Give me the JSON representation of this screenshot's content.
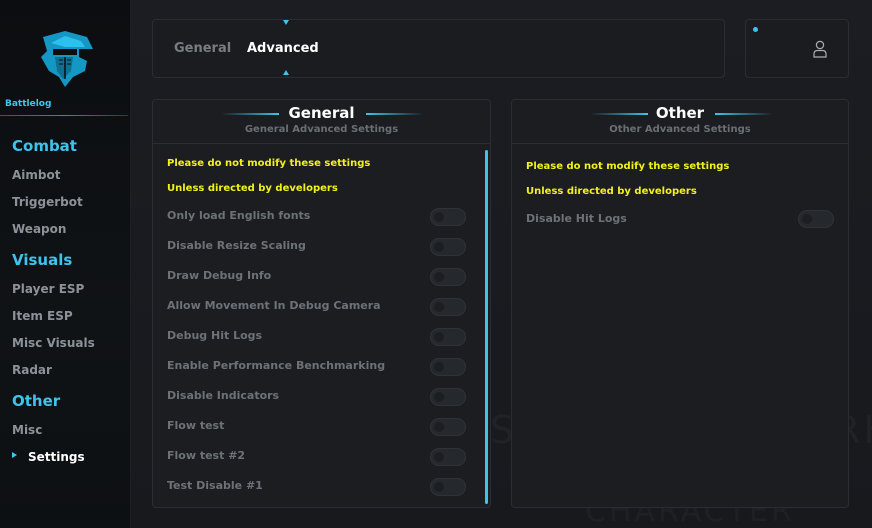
{
  "sidebar": {
    "brand": "Battlelog",
    "logo_icon": "knight-helmet-logo",
    "accent_color": "#3fc3ec",
    "sections": [
      {
        "title": "Combat",
        "items": [
          "Aimbot",
          "Triggerbot",
          "Weapon"
        ]
      },
      {
        "title": "Visuals",
        "items": [
          "Player ESP",
          "Item ESP",
          "Misc Visuals",
          "Radar"
        ]
      },
      {
        "title": "Other",
        "items": [
          "Misc",
          "Settings"
        ]
      }
    ],
    "active_item": "Settings"
  },
  "tabs": {
    "items": [
      "General",
      "Advanced"
    ],
    "active": "Advanced"
  },
  "user": {
    "icon": "user-icon",
    "status": "online"
  },
  "panels": {
    "general": {
      "title": "General",
      "subtitle": "General Advanced Settings",
      "notices": [
        "Please do not modify these settings",
        "Unless directed by developers"
      ],
      "settings": [
        {
          "label": "Only load English fonts",
          "enabled": false
        },
        {
          "label": "Disable Resize Scaling",
          "enabled": false
        },
        {
          "label": "Draw Debug Info",
          "enabled": false
        },
        {
          "label": "Allow Movement In Debug Camera",
          "enabled": false
        },
        {
          "label": "Debug Hit Logs",
          "enabled": false
        },
        {
          "label": "Enable Performance Benchmarking",
          "enabled": false
        },
        {
          "label": "Disable Indicators",
          "enabled": false
        },
        {
          "label": "Flow test",
          "enabled": false
        },
        {
          "label": "Flow test #2",
          "enabled": false
        },
        {
          "label": "Test Disable #1",
          "enabled": false
        }
      ]
    },
    "other": {
      "title": "Other",
      "subtitle": "Other Advanced Settings",
      "notices": [
        "Please do not modify these settings",
        "Unless directed by developers"
      ],
      "settings": [
        {
          "label": "Disable Hit Logs",
          "enabled": false
        }
      ]
    }
  },
  "background": {
    "watermark_1": "SCAPE FROM TARKO",
    "watermark_2": "CHARACTER"
  },
  "colors": {
    "notice": "#f2f21b",
    "accent": "#3fc3ec"
  }
}
